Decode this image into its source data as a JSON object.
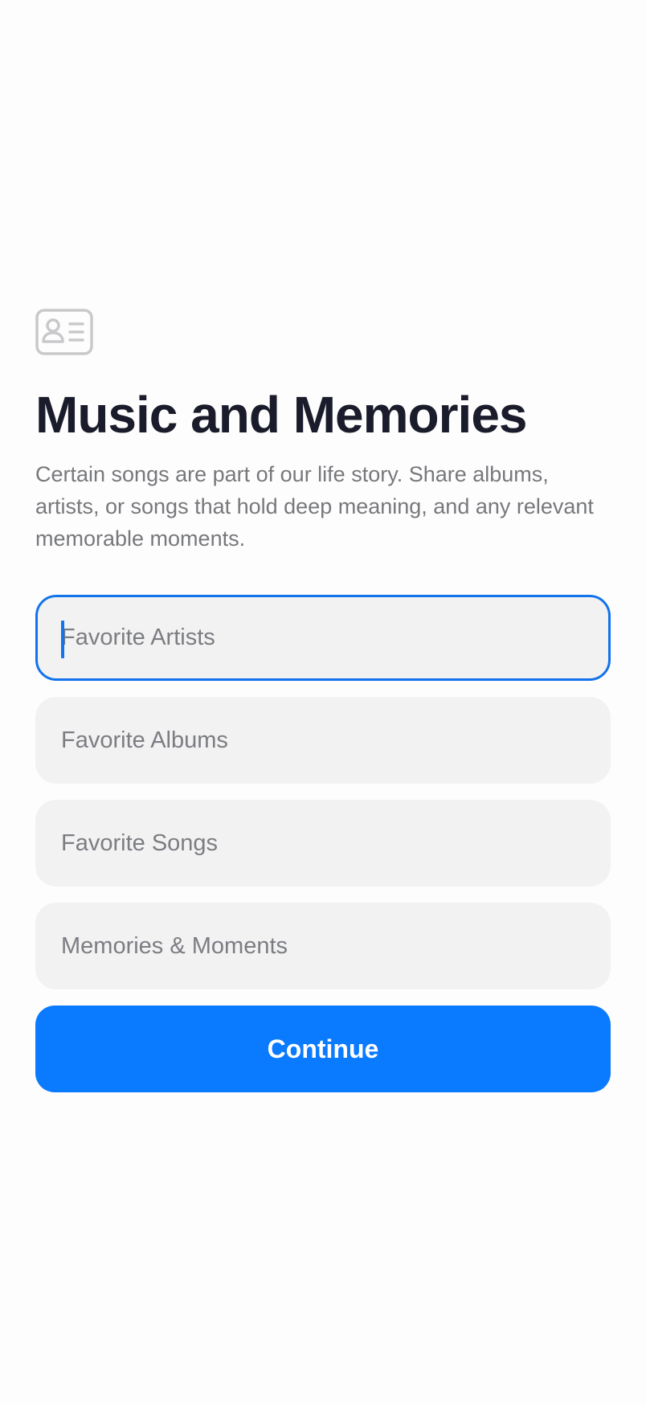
{
  "page": {
    "icon": "contact-card-icon",
    "title": "Music and Memories",
    "subtitle": "Certain songs are part of our life story. Share albums, artists, or songs that hold deep meaning, and any relevant memorable moments."
  },
  "form": {
    "fields": [
      {
        "name": "favorite-artists",
        "placeholder": "Favorite Artists",
        "value": "",
        "focused": true
      },
      {
        "name": "favorite-albums",
        "placeholder": "Favorite Albums",
        "value": ""
      },
      {
        "name": "favorite-songs",
        "placeholder": "Favorite Songs",
        "value": ""
      },
      {
        "name": "memories-moments",
        "placeholder": "Memories & Moments",
        "value": ""
      }
    ],
    "continue_label": "Continue"
  },
  "colors": {
    "accent": "#0a7aff",
    "focus_border": "#1273ec",
    "title": "#1b1c2b",
    "subtitle": "#77787c",
    "field_bg": "#f2f2f2",
    "icon": "#c9c9cc"
  }
}
